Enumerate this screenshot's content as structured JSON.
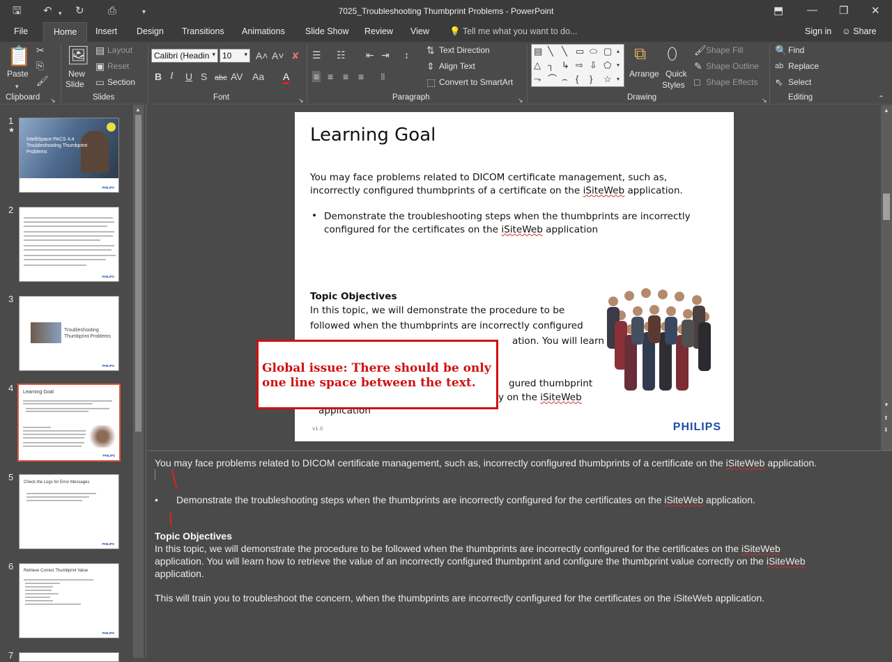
{
  "window": {
    "title": "7025_Troubleshooting Thumbprint Problems - PowerPoint"
  },
  "ribbon_tabs": [
    "File",
    "Home",
    "Insert",
    "Design",
    "Transitions",
    "Animations",
    "Slide Show",
    "Review",
    "View"
  ],
  "active_tab": "Home",
  "tell_me": "Tell me what you want to do...",
  "account": {
    "sign_in": "Sign in",
    "share": "Share"
  },
  "groups": {
    "clipboard": {
      "label": "Clipboard",
      "paste": "Paste"
    },
    "slides": {
      "label": "Slides",
      "new_slide": "New",
      "new_slide_2": "Slide",
      "layout": "Layout",
      "reset": "Reset",
      "section": "Section"
    },
    "font": {
      "label": "Font",
      "font_name": "Calibri (Headin",
      "font_size": "10"
    },
    "paragraph": {
      "label": "Paragraph",
      "text_direction": "Text Direction",
      "align_text": "Align Text",
      "convert_smartart": "Convert to SmartArt"
    },
    "drawing": {
      "label": "Drawing",
      "arrange": "Arrange",
      "quick_styles": "Quick",
      "quick_styles_2": "Styles",
      "shape_fill": "Shape Fill",
      "shape_outline": "Shape Outline",
      "shape_effects": "Shape Effects"
    },
    "editing": {
      "label": "Editing",
      "find": "Find",
      "replace": "Replace",
      "select": "Select"
    }
  },
  "thumbnails": [
    {
      "num": "1",
      "title": "IntelliSpace PACS 4.4 Troubleshooting Thumbprint Problems"
    },
    {
      "num": "2",
      "title": ""
    },
    {
      "num": "3",
      "title": "Troubleshooting Thumbprint Problems"
    },
    {
      "num": "4",
      "title": "Learning Goal"
    },
    {
      "num": "5",
      "title": "Check the Logs for Error Messages"
    },
    {
      "num": "6",
      "title": "Retrieve Correct Thumbprint Value"
    },
    {
      "num": "7",
      "title": ""
    }
  ],
  "slide": {
    "title": "Learning Goal",
    "para1_line1": "You may face problems related to DICOM certificate management, such as,",
    "para1_line2_pre": "incorrectly configured thumbprints of a certificate on the ",
    "para1_line2_link": "iSiteWeb",
    "para1_line2_post": " application.",
    "bullet_line1": "Demonstrate the troubleshooting steps when the thumbprints are incorrectly",
    "bullet_line2_pre": "configured for the certificates on the ",
    "bullet_line2_link": "iSiteWeb",
    "bullet_line2_post": " application",
    "topic_heading": "Topic Objectives",
    "topic_line1": "In this topic, we will demonstrate the procedure to be",
    "topic_line2": "followed when the thumbprints are incorrectly configured",
    "topic_line3": "ation. You will learn",
    "partial_line4": "gured thumbprint",
    "partial_line5_pre": "y on the ",
    "partial_line5_link": "iSiteWeb",
    "partial_line6": "application",
    "version": "v1.0",
    "logo": "PHILIPS"
  },
  "callout": {
    "text": "Global issue: There should be only one line space between the text."
  },
  "notes": {
    "line1_pre": "You may face problems related to DICOM certificate management, such as, incorrectly configured thumbprints of a certificate on the ",
    "line1_link": "iSiteWeb",
    "line1_post": " application.",
    "bullet_pre": "Demonstrate the troubleshooting steps when the thumbprints are incorrectly configured for the certificates on the ",
    "bullet_link": "iSiteWeb",
    "bullet_post": " application.",
    "heading": "Topic Objectives",
    "topic_line1_pre": "In this topic, we will demonstrate the procedure to be followed when the thumbprints are incorrectly configured for the certificates on the ",
    "topic_line1_link": "iSiteWeb",
    "topic_line2_pre": "application. You will learn how to retrieve the value of an incorrectly configured thumbprint and configure the thumbprint value correctly on the ",
    "topic_line2_link": "iSiteWeb",
    "topic_line3": "application.",
    "last_line": "This will train you to troubleshoot the concern, when the thumbprints are incorrectly configured for the certificates on the iSiteWeb application."
  }
}
